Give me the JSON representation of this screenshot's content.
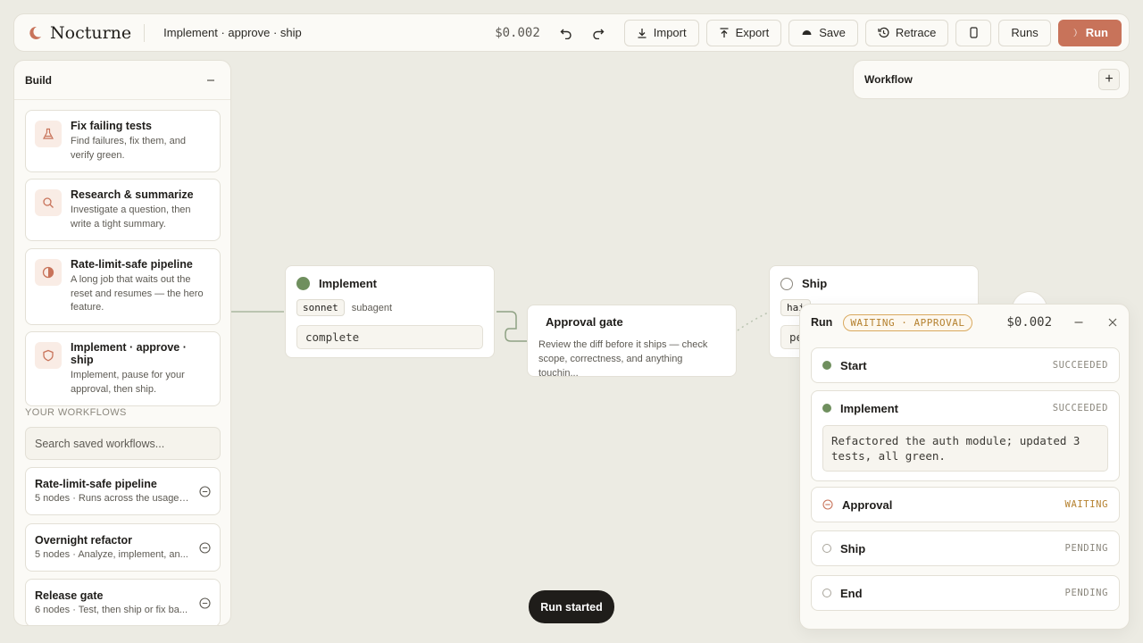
{
  "topbar": {
    "brand": "Nocturne",
    "workflow_title": "Implement · approve · ship",
    "cost": "$0.002",
    "import_label": "Import",
    "export_label": "Export",
    "save_label": "Save",
    "retrace_label": "Retrace",
    "runs_label": "Runs",
    "run_label": "Run"
  },
  "build": {
    "title": "Build",
    "templates": [
      {
        "title": "Fix failing tests",
        "desc": "Find failures, fix them, and verify green.",
        "icon": "flask-icon"
      },
      {
        "title": "Research & summarize",
        "desc": "Investigate a question, then write a tight summary.",
        "icon": "search-icon"
      },
      {
        "title": "Rate-limit-safe pipeline",
        "desc": "A long job that waits out the reset and resumes — the hero feature.",
        "icon": "half-circle-icon"
      },
      {
        "title": "Implement · approve · ship",
        "desc": "Implement, pause for your approval, then ship.",
        "icon": "shield-icon"
      }
    ],
    "section_label": "YOUR WORKFLOWS",
    "search_placeholder": "Search saved workflows...",
    "workflows": [
      {
        "title": "Rate-limit-safe pipeline",
        "desc": "5 nodes · Runs across the usage-li..."
      },
      {
        "title": "Overnight refactor",
        "desc": "5 nodes · Analyze, implement, an..."
      },
      {
        "title": "Release gate",
        "desc": "6 nodes · Test, then ship or fix ba..."
      }
    ]
  },
  "workflow_panel": {
    "title": "Workflow"
  },
  "canvas": {
    "implement": {
      "title": "Implement",
      "model": "sonnet",
      "kind": "subagent",
      "output": "complete"
    },
    "gate": {
      "title": "Approval gate",
      "desc": "Review the diff before it ships — check scope, correctness, and anything touchin..."
    },
    "ship": {
      "title": "Ship",
      "chip": "hai",
      "output": "pe"
    }
  },
  "run": {
    "title": "Run",
    "badge": "WAITING · APPROVAL",
    "cost": "$0.002",
    "steps": [
      {
        "name": "Start",
        "status": "SUCCEEDED"
      },
      {
        "name": "Implement",
        "status": "SUCCEEDED",
        "output": "Refactored the auth module; updated 3 tests, all green."
      },
      {
        "name": "Approval",
        "status": "WAITING"
      },
      {
        "name": "Ship",
        "status": "PENDING"
      },
      {
        "name": "End",
        "status": "PENDING"
      }
    ]
  },
  "toast": "Run started",
  "colors": {
    "accent": "#c8735a",
    "success": "#6f8f5e",
    "waiting": "#b5812f",
    "background": "#ecebe3"
  }
}
